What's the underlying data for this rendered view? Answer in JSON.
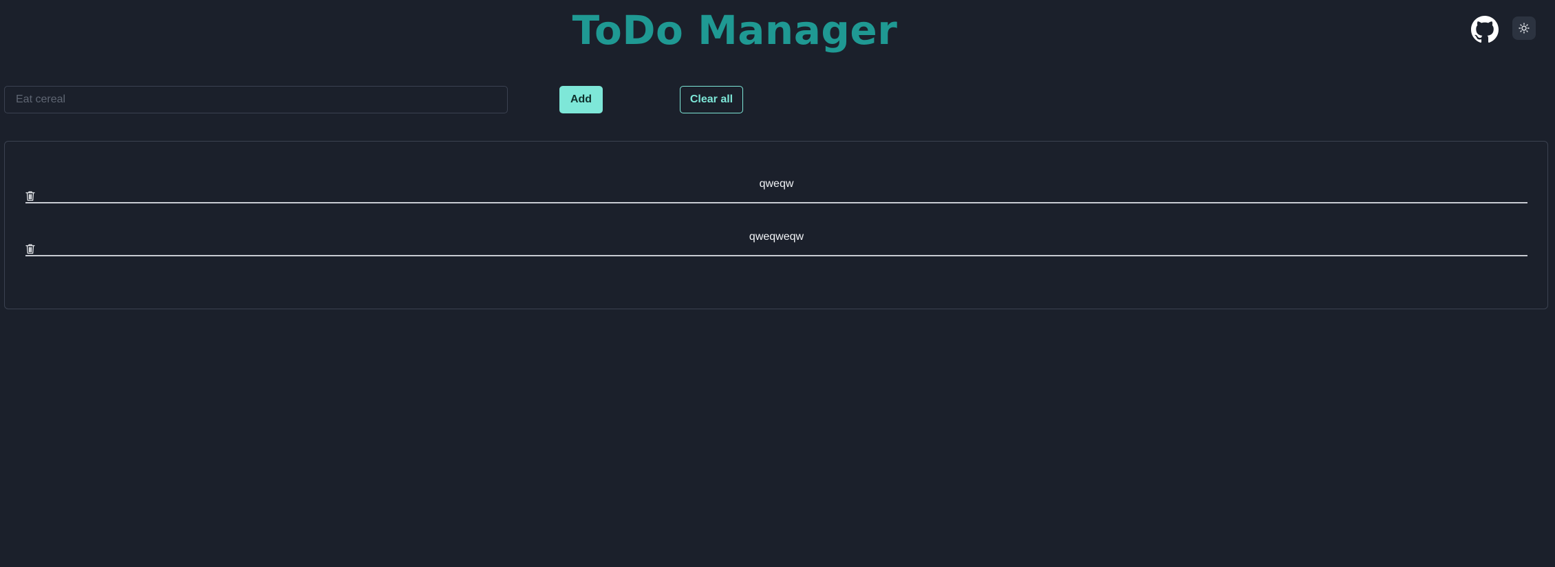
{
  "header": {
    "title": "ToDo Manager",
    "github_icon": "github-icon",
    "theme_icon": "sun-icon"
  },
  "form": {
    "input_placeholder": "Eat cereal",
    "input_value": "",
    "add_label": "Add",
    "clear_label": "Clear all"
  },
  "todos": [
    {
      "text": "qweqw",
      "delete_icon": "trash-icon"
    },
    {
      "text": "qweqweqw",
      "delete_icon": "trash-icon"
    }
  ],
  "colors": {
    "background": "#1b202b",
    "title": "#1f9993",
    "accent": "#7ee7d8",
    "accent_text": "#0f2f2b",
    "text": "#f1f3f6",
    "border": "#3b4251"
  }
}
